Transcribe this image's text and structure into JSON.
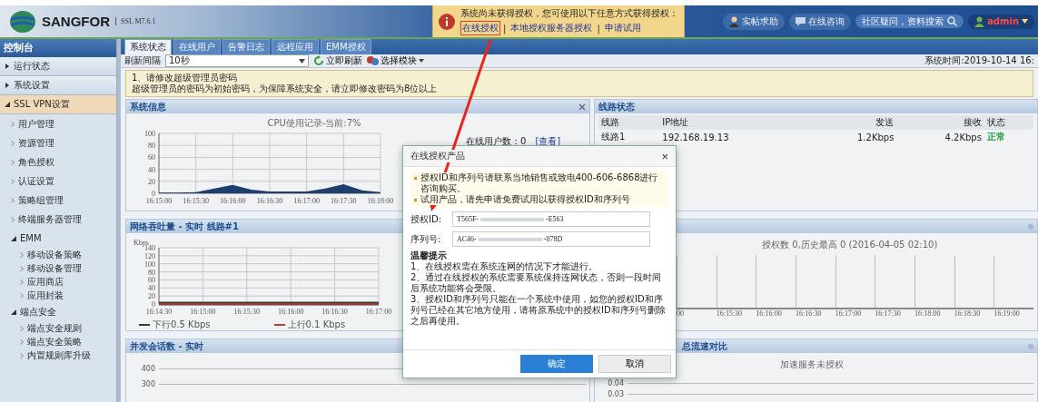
{
  "header": {
    "logo": "SANGFOR",
    "version": "SSL M7.6.1",
    "license_notice": {
      "text": "系统尚未获得授权，您可使用以下任意方式获得授权：",
      "links": [
        {
          "label": "在线授权",
          "highlighted": true
        },
        {
          "label": "本地授权服务器授权",
          "highlighted": false
        },
        {
          "label": "申请试用",
          "highlighted": false
        }
      ],
      "separator": "|"
    },
    "actions": [
      {
        "kind": "help",
        "label": "实帖求助"
      },
      {
        "kind": "chat",
        "label": "在线咨询"
      }
    ],
    "search": {
      "placeholder": "社区疑问，资料搜索"
    },
    "user": {
      "name": "admin"
    }
  },
  "sidebar": {
    "title": "控制台",
    "items": [
      {
        "label": "运行状态",
        "expanded": false,
        "selected": false
      },
      {
        "label": "系统设置",
        "expanded": false,
        "selected": false
      },
      {
        "label": "SSL VPN设置",
        "expanded": true,
        "selected": true,
        "children": [
          {
            "label": "用户管理"
          },
          {
            "label": "资源管理"
          },
          {
            "label": "角色授权"
          },
          {
            "label": "认证设置"
          },
          {
            "label": "策略组管理"
          },
          {
            "label": "终端服务器管理"
          },
          {
            "label": "EMM",
            "expanded": true,
            "children": [
              {
                "label": "移动设备策略"
              },
              {
                "label": "移动设备管理"
              },
              {
                "label": "应用商店"
              },
              {
                "label": "应用封装"
              }
            ]
          },
          {
            "label": "端点安全",
            "expanded": true,
            "children": [
              {
                "label": "端点安全规则"
              },
              {
                "label": "端点安全策略"
              },
              {
                "label": "内置规则库升级"
              }
            ]
          }
        ]
      }
    ]
  },
  "tabs": [
    {
      "label": "系统状态",
      "selected": true
    },
    {
      "label": "在线用户",
      "selected": false
    },
    {
      "label": "告警日志",
      "selected": false
    },
    {
      "label": "远程应用",
      "selected": false
    },
    {
      "label": "EMM授权",
      "selected": false
    }
  ],
  "toolbar": {
    "refresh_label": "刷新间隔",
    "refresh_value": "10秒",
    "refresh_now": "立即刷新",
    "select_module": "选择模块",
    "system_time": "系统时间:2019-10-14 16:"
  },
  "alert": {
    "title": "1、请修改超级管理员密码",
    "text": "超级管理员的密码为初始密码，为保障系统安全，请立即修改密码为8位以上"
  },
  "system_info": {
    "title": "系统信息",
    "online_users": "在线用户数：0",
    "view_link": "[查看]",
    "chart_data": {
      "type": "area",
      "title": "CPU使用记录-当前:7%",
      "categories": [
        "16:15:00",
        null,
        "16:15:30",
        null,
        "16:16:00",
        null,
        "16:16:30",
        null,
        "16:17:00",
        null,
        "16:17:30",
        null,
        "16:18:00"
      ],
      "series": [
        {
          "color": "#1f3f6f",
          "values": [
            1,
            1,
            2,
            8,
            14,
            6,
            3,
            3,
            3,
            8,
            15,
            5,
            2
          ]
        }
      ],
      "ylim": [
        0,
        100
      ],
      "yticks": [
        0,
        20,
        40,
        60,
        80,
        100
      ],
      "grid": true
    }
  },
  "throughput": {
    "title": "网络吞吐量 - 实时 线路#1",
    "chart_data": {
      "type": "line",
      "ylabel": "Kbps",
      "categories": [
        "16:14:30",
        "16:15:00",
        "16:15:30",
        "16:16:00",
        "16:16:30",
        "16:17:00"
      ],
      "series": [
        {
          "name": "下行0.5 Kbps",
          "color": "#3a3a3a",
          "values": [
            1,
            1,
            1,
            1,
            1,
            1
          ]
        },
        {
          "name": "上行0.1 Kbps",
          "color": "#c0392b",
          "values": [
            0,
            0,
            0,
            0,
            0,
            0
          ]
        }
      ],
      "ylim": [
        0,
        140
      ],
      "yticks": [
        0,
        20,
        40,
        60,
        80,
        100,
        120,
        140
      ],
      "grid": true
    }
  },
  "sessions": {
    "title": "并发会话数 - 实时",
    "axis_labels": [
      "400",
      "300"
    ]
  },
  "line_status": {
    "title": "线路状态",
    "columns": [
      "线路",
      "IP地址",
      "发送",
      "接收",
      "状态"
    ],
    "rows": [
      {
        "cells": [
          "线路1",
          "192.168.19.13",
          "1.2Kbps",
          "4.2Kbps",
          "正常"
        ],
        "color": "#1a9a3a"
      }
    ]
  },
  "license_chart": {
    "caption": "授权数 0,历史最高 0 (2016-04-05 02:10)",
    "time_labels": [
      "00",
      "16:15:30",
      "16:16:00",
      "16:16:30",
      "16:17:00",
      "16:17:30",
      "16:18:00",
      "16:18:30",
      "16:19:00"
    ]
  },
  "speed_compare": {
    "title": "总流速对比",
    "caption": "加速服务未授权",
    "axis_labels": [
      "0.04",
      "0.03"
    ]
  },
  "dialog": {
    "title": "在线授权产品",
    "close": "×",
    "notes": [
      "授权ID和序列号请联系当地销售或致电400-606-6868进行咨询购买。",
      "试用产品，请先申请免费试用以获得授权ID和序列号"
    ],
    "fields": [
      {
        "label": "授权ID:",
        "value_start": "T565F-",
        "value_end": "-E563"
      },
      {
        "label": "序列号:",
        "value_start": "AC46-",
        "value_end": "-078D"
      }
    ],
    "tips_title": "温馨提示",
    "tips": [
      "1、在线授权需在系统连网的情况下才能进行。",
      "2、通过在线授权的系统需要系统保持连网状态，否则一段时间后系统功能将会受限。",
      "3、授权ID和序列号只能在一个系统中使用，如您的授权ID和序列号已经在其它地方使用，请将原系统中的授权ID和序列号删除之后再使用。"
    ],
    "buttons": [
      {
        "label": "确定",
        "kind": "primary"
      },
      {
        "label": "取消",
        "kind": "secondary"
      }
    ]
  },
  "annotation": {
    "arrow": true
  }
}
